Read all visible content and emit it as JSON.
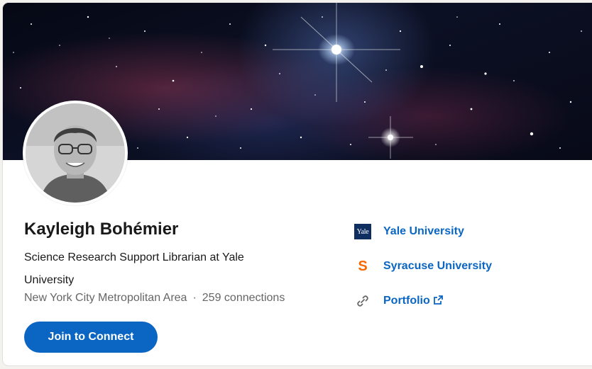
{
  "profile": {
    "name": "Kayleigh Bohémier",
    "headline": "Science Research Support Librarian at Yale University",
    "location": "New York City Metropolitan Area",
    "separator": "·",
    "connections": "259 connections",
    "join_button_label": "Join to Connect"
  },
  "side_links": [
    {
      "label": "Yale University",
      "logo_text": "Yale",
      "icon": "yale-logo"
    },
    {
      "label": "Syracuse University",
      "logo_text": "S",
      "icon": "syracuse-logo"
    },
    {
      "label": "Portfolio",
      "icon": "link-icon"
    }
  ],
  "colors": {
    "accent": "#0a66c2",
    "yale_blue": "#0f2f61",
    "syracuse_orange": "#f76900",
    "muted_text": "#666666"
  }
}
